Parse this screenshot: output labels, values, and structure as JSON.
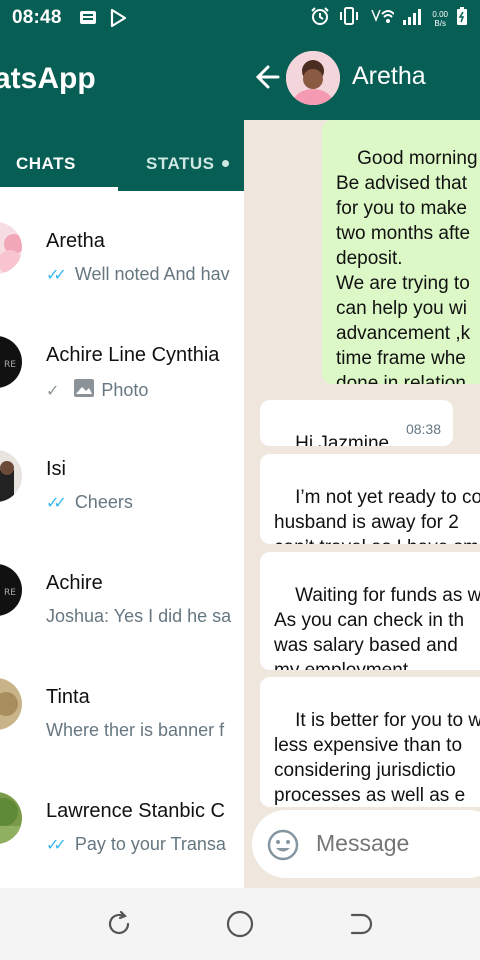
{
  "status_bar": {
    "time": "08:48",
    "net_speed_value": "0.00",
    "net_speed_unit": "B/s",
    "icons": [
      "message-icon",
      "play-icon",
      "alarm-icon",
      "vibrate-icon",
      "wifi-icon",
      "signal-icon",
      "battery-icon"
    ]
  },
  "chat_list": {
    "app_title": "atsApp",
    "tabs": [
      {
        "label": "CHATS",
        "selected": true
      },
      {
        "label": "STATUS",
        "selected": false
      }
    ],
    "chats": [
      {
        "name": "Aretha",
        "preview": "Well noted And hav",
        "tick": "read"
      },
      {
        "name": "Achire Line Cynthia",
        "preview": "Photo",
        "tick": "sent"
      },
      {
        "name": "Isi",
        "preview": "Cheers",
        "tick": "read"
      },
      {
        "name": "Achire",
        "preview": "Joshua:  Yes I did he sa",
        "tick": "none"
      },
      {
        "name": "Tinta",
        "preview": "Where ther is banner f",
        "tick": "none"
      },
      {
        "name": "Lawrence Stanbic C",
        "preview": "Pay to your Transa",
        "tick": "read"
      }
    ]
  },
  "conversation": {
    "contact_name": "Aretha",
    "messages": [
      {
        "direction": "out",
        "text": "Good morning\nBe advised that\nfor you to make\ntwo months afte\ndeposit.\nWe are trying to\ncan help you wi\nadvancement ,k\ntime frame whe\ndone in relation"
      },
      {
        "direction": "in",
        "text": "Hi Jazmine",
        "time": "08:38"
      },
      {
        "direction": "in",
        "text": "I’m not yet ready to co\nhusband is away for 2\ncan’t travel as I have sm"
      },
      {
        "direction": "in",
        "text": "Waiting for funds as w\nAs you can check in th\nwas salary based and\nmy employment"
      },
      {
        "direction": "in",
        "text": "It is better for you to w\nless expensive than to\nconsidering jurisdictio\nprocesses as well as e\na foreign judgment"
      }
    ],
    "composer_placeholder": "Message"
  },
  "nav_bar": {
    "buttons": [
      "recents-button",
      "home-button",
      "back-button"
    ]
  },
  "colors": {
    "header": "#075e54",
    "outgoing_bubble": "#dcf8c6",
    "incoming_bubble": "#ffffff",
    "chat_background": "#efe7dd",
    "read_tick": "#34b7f1"
  }
}
